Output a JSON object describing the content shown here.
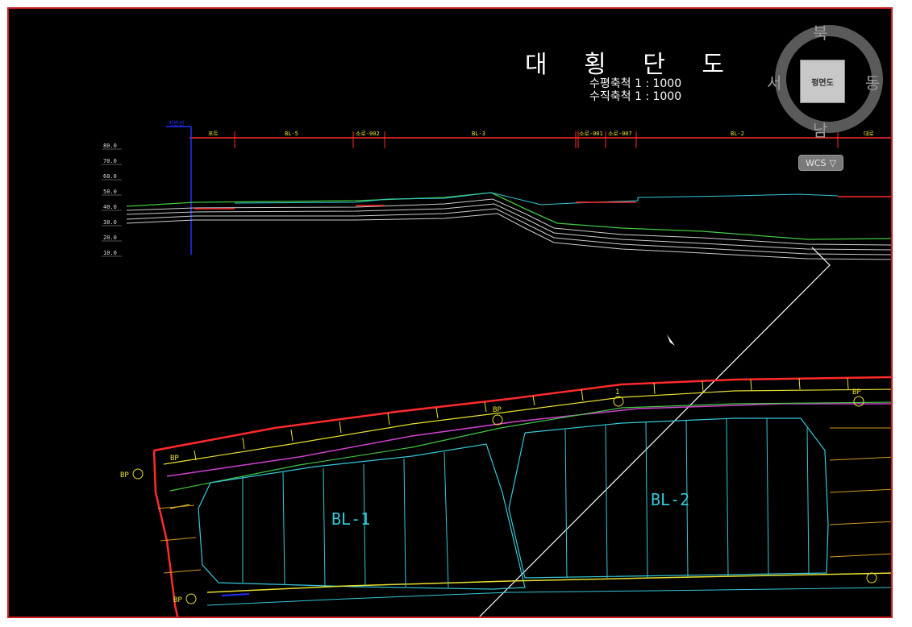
{
  "title": "대 횡 단 도",
  "scale_horizontal": "수평축척 1 : 1000",
  "scale_vertical": "수직축척 1 : 1000",
  "viewcube": {
    "north": "북",
    "south": "남",
    "west": "서",
    "east": "동",
    "face": "평면도"
  },
  "wcs": {
    "label": "WCS",
    "arrow": "▽"
  },
  "profile": {
    "start_label": "지반선",
    "segments": [
      "포트",
      "BL-5",
      "소로-002",
      "BL-3",
      "소로-001",
      "소로-007",
      "BL-2",
      "대로"
    ],
    "elevations": [
      "80.0",
      "70.0",
      "60.0",
      "50.0",
      "40.0",
      "30.0",
      "20.0",
      "10.0"
    ]
  },
  "plan": {
    "block_labels": [
      "BL-1",
      "BL-2"
    ],
    "bp_labels": [
      "BP",
      "BP",
      "BP",
      "BP",
      "BP"
    ],
    "point_label": "1"
  },
  "colors": {
    "frame": "#c81e1e",
    "cyan": "#35c8d8",
    "yellow": "#e8e030",
    "green": "#40c840",
    "magenta": "#d040d0",
    "red": "#ff2a2a",
    "blue": "#2030ff"
  }
}
